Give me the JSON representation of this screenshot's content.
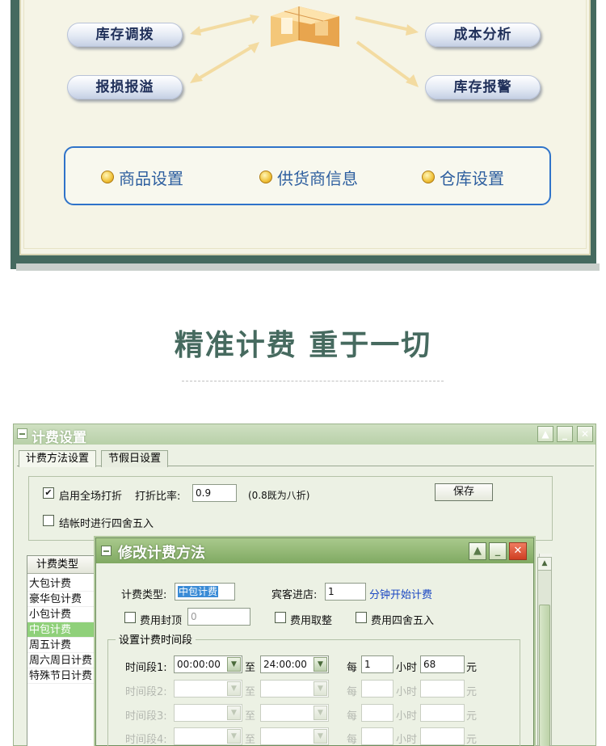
{
  "top_panel": {
    "left_buttons": [
      "库存调拨",
      "报损报溢"
    ],
    "right_buttons": [
      "成本分析",
      "库存报警"
    ],
    "links": [
      "商品设置",
      "供货商信息",
      "仓库设置"
    ]
  },
  "headline": "精准计费 重于一切",
  "window": {
    "title": "计费设置",
    "tabs": [
      "计费方法设置",
      "节假日设置"
    ],
    "discount": {
      "enable_label": "启用全场打折",
      "rate_label": "打折比率:",
      "rate_value": "0.9",
      "hint": "(0.8既为八折)",
      "save_label": "保存",
      "round_label": "结帐时进行四舍五入"
    },
    "list": {
      "header": "计费类型",
      "items": [
        "大包计费",
        "豪华包计费",
        "小包计费",
        "中包计费",
        "周五计费",
        "周六周日计费",
        "特殊节日计费"
      ],
      "selected": "中包计费",
      "col_fragment": "0"
    }
  },
  "dialog": {
    "title": "修改计费方法",
    "type_label": "计费类型:",
    "type_value": "中包计费",
    "guest_label": "宾客进店:",
    "guest_value": "1",
    "guest_suffix": "分钟开始计费",
    "cap_label": "费用封顶",
    "cap_value": "0",
    "round_label": "费用取整",
    "round4_label": "费用四舍五入",
    "section_label": "设置计费时间段",
    "periods": [
      {
        "label": "时间段1:",
        "from": "00:00:00",
        "to_label": "至",
        "to": "24:00:00",
        "per": "每",
        "hours": "1",
        "hour_unit": "小时",
        "price": "68",
        "yuan": "元",
        "enabled": true
      },
      {
        "label": "时间段2:",
        "from": "",
        "to_label": "至",
        "to": "",
        "per": "每",
        "hours": "",
        "hour_unit": "小时",
        "price": "",
        "yuan": "元",
        "enabled": false
      },
      {
        "label": "时间段3:",
        "from": "",
        "to_label": "至",
        "to": "",
        "per": "每",
        "hours": "",
        "hour_unit": "小时",
        "price": "",
        "yuan": "元",
        "enabled": false
      },
      {
        "label": "时间段4:",
        "from": "",
        "to_label": "至",
        "to": "",
        "per": "每",
        "hours": "",
        "hour_unit": "小时",
        "price": "",
        "yuan": "元",
        "enabled": false
      }
    ]
  },
  "colors": {
    "frame_green": "#456a5f",
    "panel_bg": "#f5f4e6",
    "link_blue": "#2e5f9f",
    "headline": "#466a5f",
    "selected_row": "#8fd07a"
  }
}
